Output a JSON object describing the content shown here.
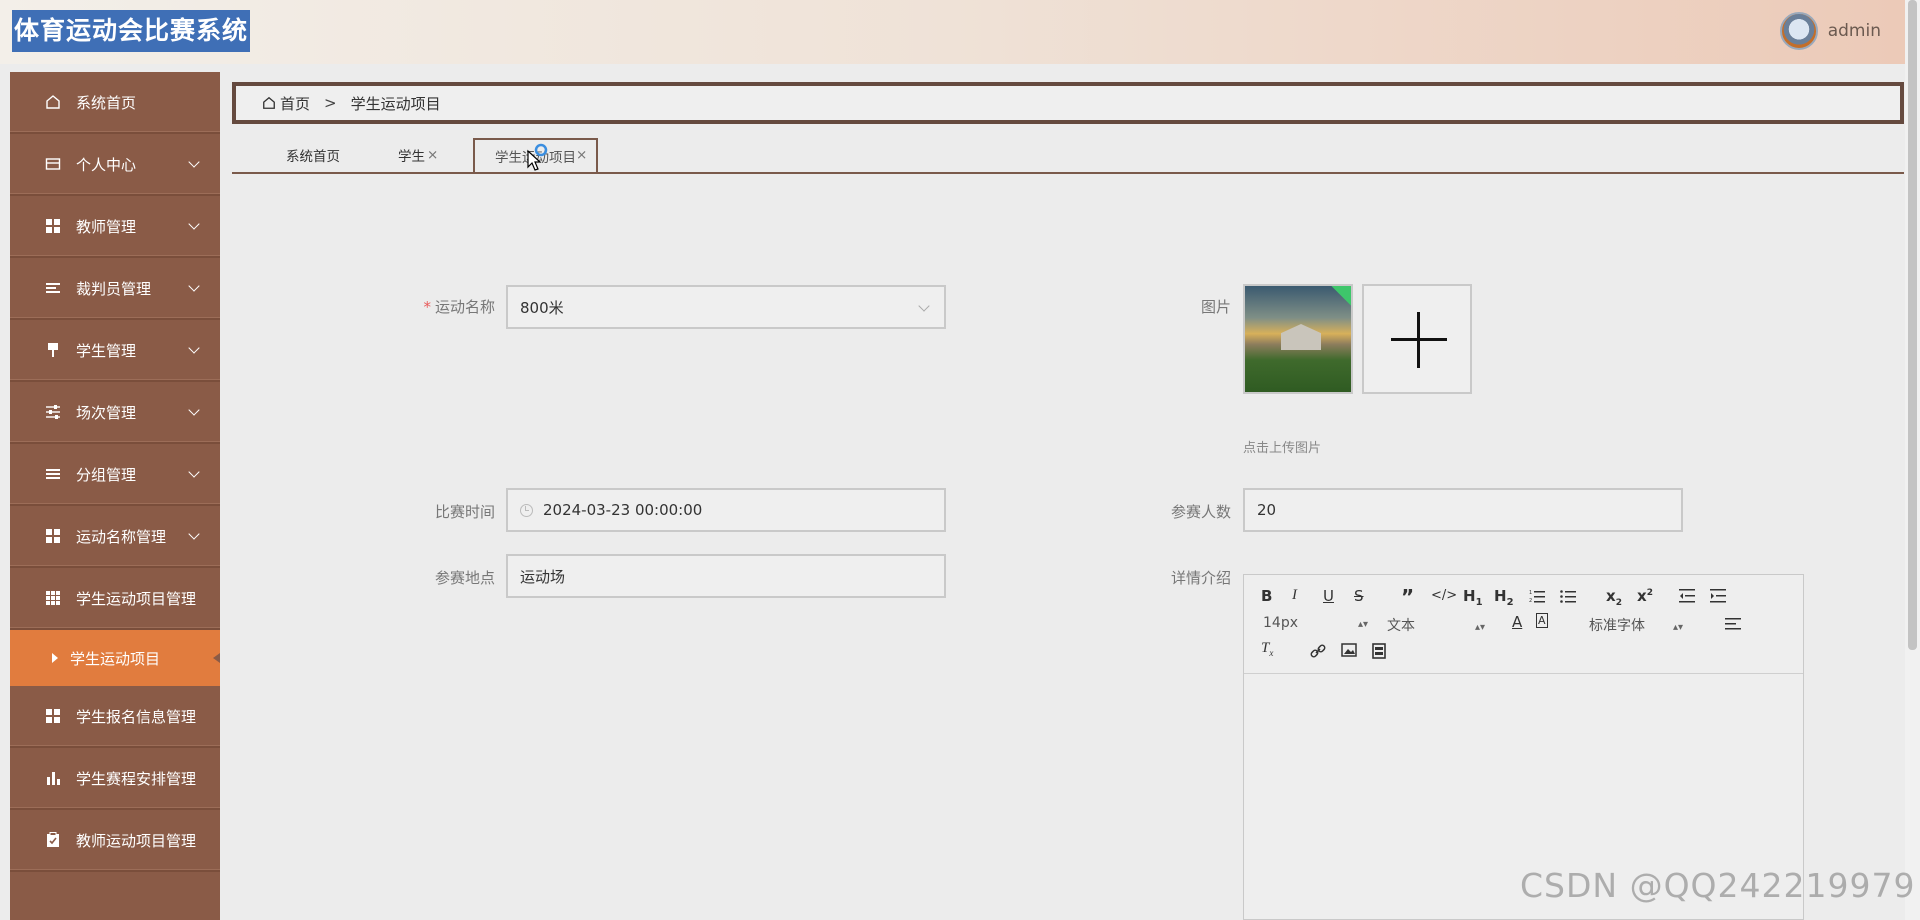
{
  "header": {
    "app_title": "体育运动会比赛系统",
    "user_name": "admin"
  },
  "sidebar": {
    "items": [
      {
        "label": "系统首页",
        "icon": "home-icon",
        "has_arrow": false
      },
      {
        "label": "个人中心",
        "icon": "card-icon",
        "has_arrow": true
      },
      {
        "label": "教师管理",
        "icon": "grid-icon",
        "has_arrow": true
      },
      {
        "label": "裁判员管理",
        "icon": "list-icon",
        "has_arrow": true
      },
      {
        "label": "学生管理",
        "icon": "brush-icon",
        "has_arrow": true
      },
      {
        "label": "场次管理",
        "icon": "sliders-icon",
        "has_arrow": true
      },
      {
        "label": "分组管理",
        "icon": "list-icon",
        "has_arrow": true
      },
      {
        "label": "运动名称管理",
        "icon": "grid-icon",
        "has_arrow": true
      },
      {
        "label": "学生运动项目管理",
        "icon": "table-icon",
        "has_arrow": false
      }
    ],
    "active_sub": "学生运动项目",
    "items_after": [
      {
        "label": "学生报名信息管理",
        "icon": "grid-icon"
      },
      {
        "label": "学生赛程安排管理",
        "icon": "bar-chart-icon"
      },
      {
        "label": "教师运动项目管理",
        "icon": "clipboard-icon"
      }
    ]
  },
  "breadcrumb": {
    "home": "首页",
    "separator": ">",
    "current": "学生运动项目"
  },
  "tabs": [
    {
      "label": "系统首页",
      "closable": false
    },
    {
      "label": "学生",
      "closable": true
    },
    {
      "label": "学生运动项目",
      "closable": true,
      "active": true
    }
  ],
  "form": {
    "sport_name": {
      "label": "运动名称",
      "required": true,
      "value": "800米"
    },
    "image": {
      "label": "图片",
      "hint": "点击上传图片"
    },
    "match_time": {
      "label": "比赛时间",
      "value": "2024-03-23 00:00:00"
    },
    "participants": {
      "label": "参赛人数",
      "value": "20"
    },
    "venue": {
      "label": "参赛地点",
      "value": "运动场"
    },
    "details": {
      "label": "详情介绍"
    }
  },
  "editor": {
    "font_size": "14px",
    "block_type": "文本",
    "font_family": "标准字体"
  },
  "watermark": "CSDN @QQ242219979"
}
